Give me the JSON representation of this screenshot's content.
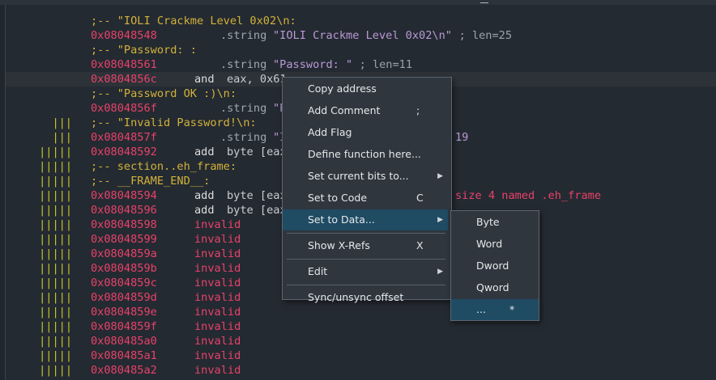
{
  "listing": {
    "rows": [
      {
        "gutter": "",
        "type": "comment",
        "text": ";-- \"IOLI Crackme Level 0x02\\n:"
      },
      {
        "gutter": "",
        "type": "string",
        "addr": "0x08048548",
        "directive": ".string",
        "value": "\"IOLI Crackme Level 0x02\\n\"",
        "comment": " ; len=25"
      },
      {
        "gutter": "",
        "type": "comment",
        "text": ";-- \"Password: :"
      },
      {
        "gutter": "",
        "type": "string",
        "addr": "0x08048561",
        "directive": ".string",
        "value": "\"Password: \"",
        "comment": " ; len=11"
      },
      {
        "gutter": "",
        "type": "instr",
        "addr": "0x0804856c",
        "mnemonic": "and",
        "operands": "eax, 0x61",
        "highlight": true
      },
      {
        "gutter": "",
        "type": "comment",
        "text": ";-- \"Password OK :)\\n:"
      },
      {
        "gutter": "",
        "type": "string",
        "addr": "0x0804856f",
        "directive": ".string",
        "value": "\"P",
        "comment": ""
      },
      {
        "gutter": "|||",
        "type": "comment",
        "text": ";-- \"Invalid Password!\\n:"
      },
      {
        "gutter": "|||",
        "type": "string",
        "addr": "0x0804857f",
        "directive": ".string",
        "value": "\"I",
        "comment": "",
        "tail": "19"
      },
      {
        "gutter": "|||||",
        "type": "instr",
        "addr": "0x08048592",
        "mnemonic": "add",
        "operands": "byte [eax"
      },
      {
        "gutter": "|||||",
        "type": "comment",
        "text": ";-- section..eh_frame:"
      },
      {
        "gutter": "|||||",
        "type": "comment",
        "text": ";-- __FRAME_END__:"
      },
      {
        "gutter": "|||||",
        "type": "instr",
        "addr": "0x08048594",
        "mnemonic": "add",
        "operands": "byte [eax",
        "tail": "size 4 named .eh_frame"
      },
      {
        "gutter": "|||||",
        "type": "instr",
        "addr": "0x08048596",
        "mnemonic": "add",
        "operands": "byte [eax"
      },
      {
        "gutter": "|||||",
        "type": "invalid",
        "addr": "0x08048598",
        "mnemonic": "invalid"
      },
      {
        "gutter": "|||||",
        "type": "invalid",
        "addr": "0x08048599",
        "mnemonic": "invalid"
      },
      {
        "gutter": "|||||",
        "type": "invalid",
        "addr": "0x0804859a",
        "mnemonic": "invalid"
      },
      {
        "gutter": "|||||",
        "type": "invalid",
        "addr": "0x0804859b",
        "mnemonic": "invalid"
      },
      {
        "gutter": "|||||",
        "type": "invalid",
        "addr": "0x0804859c",
        "mnemonic": "invalid"
      },
      {
        "gutter": "|||||",
        "type": "invalid",
        "addr": "0x0804859d",
        "mnemonic": "invalid"
      },
      {
        "gutter": "|||||",
        "type": "invalid",
        "addr": "0x0804859e",
        "mnemonic": "invalid"
      },
      {
        "gutter": "|||||",
        "type": "invalid",
        "addr": "0x0804859f",
        "mnemonic": "invalid"
      },
      {
        "gutter": "|||||",
        "type": "invalid",
        "addr": "0x080485a0",
        "mnemonic": "invalid"
      },
      {
        "gutter": "|||||",
        "type": "invalid",
        "addr": "0x080485a1",
        "mnemonic": "invalid"
      },
      {
        "gutter": "|||||",
        "type": "invalid",
        "addr": "0x080485a2",
        "mnemonic": "invalid"
      }
    ]
  },
  "context_menu": {
    "items": [
      {
        "label": "Copy address"
      },
      {
        "label": "Add Comment",
        "shortcut": ";"
      },
      {
        "label": "Add Flag"
      },
      {
        "label": "Define function here..."
      },
      {
        "label": "Set current bits to...",
        "submenu": true
      },
      {
        "label": "Set to Code",
        "shortcut": "C"
      },
      {
        "label": "Set to Data...",
        "submenu": true,
        "selected": true
      },
      {
        "separator": true
      },
      {
        "label": "Show X-Refs",
        "shortcut": "X"
      },
      {
        "separator": true
      },
      {
        "label": "Edit",
        "submenu": true
      },
      {
        "separator": true
      },
      {
        "label": "Sync/unsync offset"
      }
    ]
  },
  "data_submenu": {
    "items": [
      {
        "label": "Byte"
      },
      {
        "label": "Word"
      },
      {
        "label": "Dword"
      },
      {
        "label": "Qword"
      },
      {
        "label": "...",
        "shortcut": "*",
        "selected": true
      }
    ]
  },
  "icons": {
    "submenu_arrow": "chevron-right-icon"
  },
  "colors": {
    "address": "#e7426b",
    "comment": "#d2b23c",
    "selection": "#1f4b63",
    "string": "#b99ad8"
  }
}
